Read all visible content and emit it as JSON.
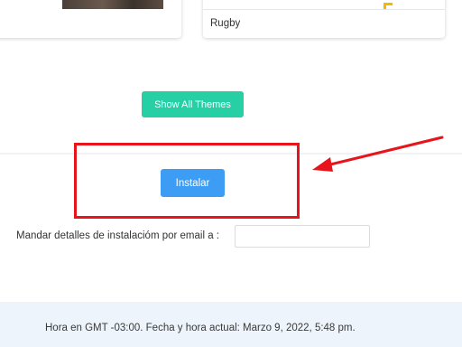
{
  "theme_cards": [
    {
      "title": ""
    },
    {
      "title": "Rugby"
    }
  ],
  "themes": {
    "show_all_label": "Show All Themes"
  },
  "install": {
    "button_label": "Instalar"
  },
  "email": {
    "label": "Mandar detalles de instalacióm por email a :",
    "value": "",
    "placeholder": ""
  },
  "footer": {
    "text": "Hora en GMT -03:00. Fecha y hora actual: Marzo 9, 2022, 5:48 pm."
  },
  "annotation": {
    "color": "#e8141b"
  },
  "colors": {
    "themes_button": "#26cfa4",
    "install_button": "#3d9df5",
    "background": "#f0f2f5",
    "footer_bg": "#eef4fb"
  }
}
